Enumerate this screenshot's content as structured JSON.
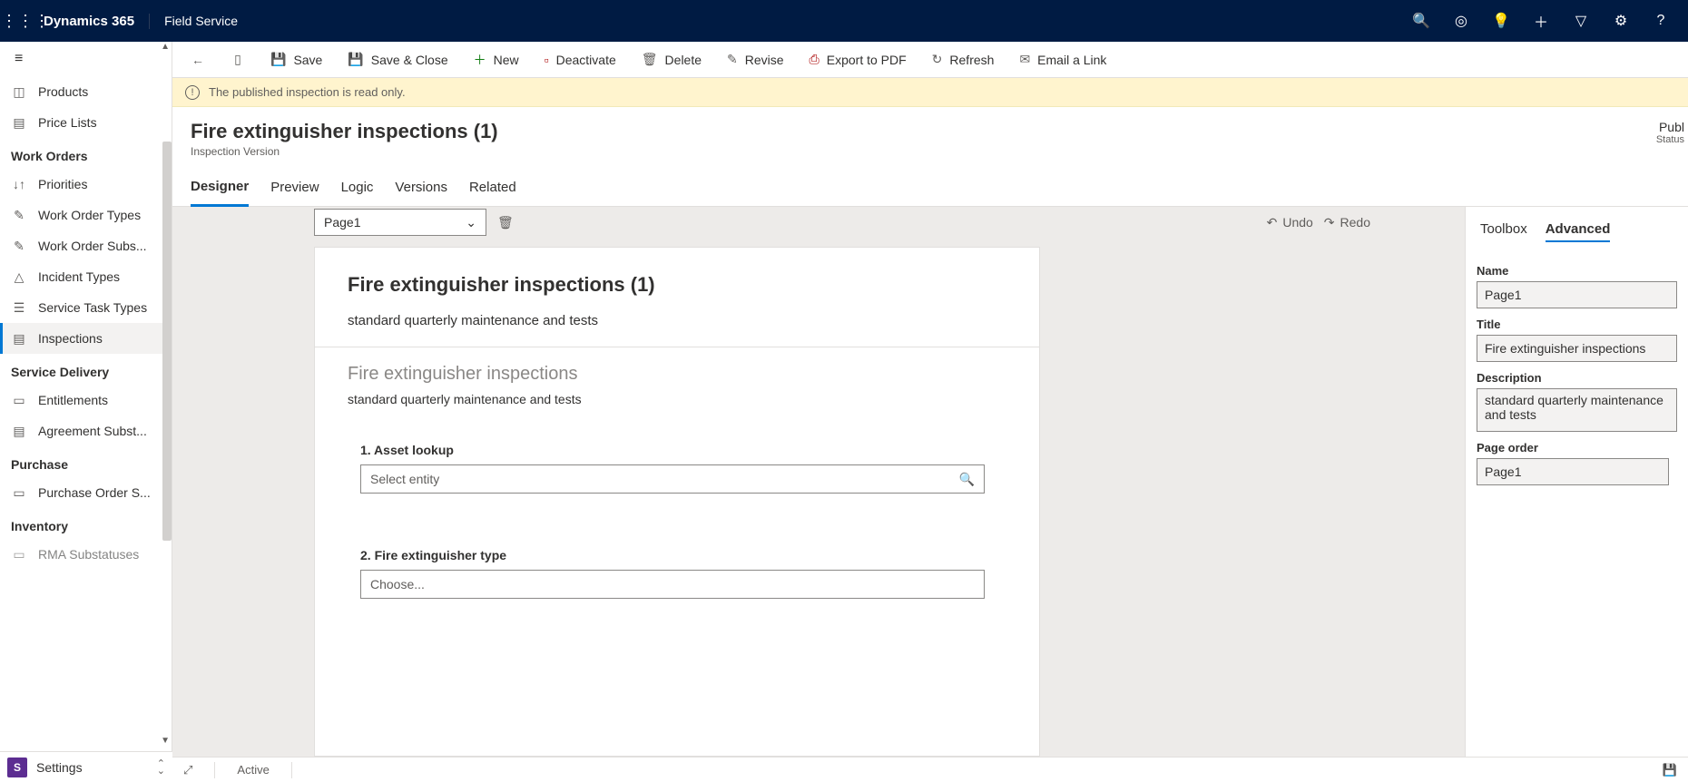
{
  "topbar": {
    "brand": "Dynamics 365",
    "module": "Field Service"
  },
  "sidebar": {
    "items_top": [
      {
        "label": "Products",
        "icon": "◫"
      },
      {
        "label": "Price Lists",
        "icon": "▤"
      }
    ],
    "group_work_orders": "Work Orders",
    "work_orders_items": [
      {
        "label": "Priorities",
        "icon": "↓↑"
      },
      {
        "label": "Work Order Types",
        "icon": "✎"
      },
      {
        "label": "Work Order Subs...",
        "icon": "✎"
      },
      {
        "label": "Incident Types",
        "icon": "△"
      },
      {
        "label": "Service Task Types",
        "icon": "☰"
      },
      {
        "label": "Inspections",
        "icon": "▤",
        "active": true
      }
    ],
    "group_service_delivery": "Service Delivery",
    "service_delivery_items": [
      {
        "label": "Entitlements",
        "icon": "▭"
      },
      {
        "label": "Agreement Subst...",
        "icon": "▤"
      }
    ],
    "group_purchase": "Purchase",
    "purchase_items": [
      {
        "label": "Purchase Order S...",
        "icon": "▭"
      }
    ],
    "group_inventory": "Inventory",
    "inventory_items": [
      {
        "label": "RMA Substatuses",
        "icon": "▭"
      }
    ],
    "footer_badge": "S",
    "footer_label": "Settings"
  },
  "commands": {
    "save": "Save",
    "save_close": "Save & Close",
    "new": "New",
    "deactivate": "Deactivate",
    "delete": "Delete",
    "revise": "Revise",
    "export_pdf": "Export to PDF",
    "refresh": "Refresh",
    "email_link": "Email a Link"
  },
  "warning": "The published inspection is read only.",
  "record": {
    "title": "Fire extinguisher inspections (1)",
    "subtitle": "Inspection Version",
    "status_value": "Publ",
    "status_label": "Status"
  },
  "tabs": [
    "Designer",
    "Preview",
    "Logic",
    "Versions",
    "Related"
  ],
  "active_tab": "Designer",
  "designer": {
    "page_dropdown": "Page1",
    "undo": "Undo",
    "redo": "Redo",
    "canvas": {
      "title": "Fire extinguisher inspections (1)",
      "desc": "standard quarterly maintenance and tests",
      "section_title": "Fire extinguisher inspections",
      "section_desc": "standard quarterly maintenance and tests",
      "q1_label": "1. Asset lookup",
      "q1_placeholder": "Select entity",
      "q2_label": "2. Fire extinguisher type",
      "q2_placeholder": "Choose..."
    }
  },
  "prop_panel": {
    "tabs": [
      "Toolbox",
      "Advanced"
    ],
    "active": "Advanced",
    "name_label": "Name",
    "name_value": "Page1",
    "title_label": "Title",
    "title_value": "Fire extinguisher inspections",
    "desc_label": "Description",
    "desc_value": "standard quarterly maintenance and tests",
    "pageorder_label": "Page order",
    "pageorder_value": "Page1"
  },
  "statusbar": {
    "active": "Active"
  }
}
